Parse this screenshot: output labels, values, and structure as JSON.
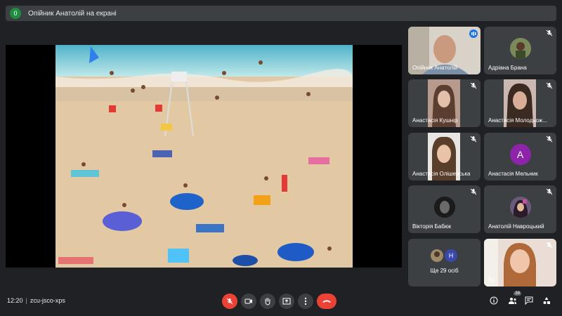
{
  "banner": {
    "badge": "0",
    "text": "Опійник Анатолій на екрані"
  },
  "participants": [
    {
      "name": "Опійник Анатолій",
      "speaking": true
    },
    {
      "name": "Адріана Брана",
      "muted": true
    },
    {
      "name": "Анастасія Кушнір",
      "muted": true
    },
    {
      "name": "Анастасія Молодьож...",
      "muted": true
    },
    {
      "name": "Анастасія Олішевська",
      "muted": true
    },
    {
      "name": "Анастасія Мельник",
      "muted": true,
      "initial": "A",
      "color": "#8e24aa"
    },
    {
      "name": "Вікторія Бабюк",
      "muted": true
    },
    {
      "name": "Анатолій Навроцький",
      "muted": true
    },
    {
      "name": "Ще 29 осіб",
      "initial": "H",
      "color": "#3949ab"
    },
    {
      "name": "Ви",
      "muted": true
    }
  ],
  "bottom": {
    "time": "12:20",
    "meeting_code": "zcu-jsco-xps",
    "people_count": "39"
  },
  "colors": {
    "background": "#202124",
    "tile": "#3c4043",
    "danger": "#ea4335",
    "accent": "#8ab4f8"
  }
}
